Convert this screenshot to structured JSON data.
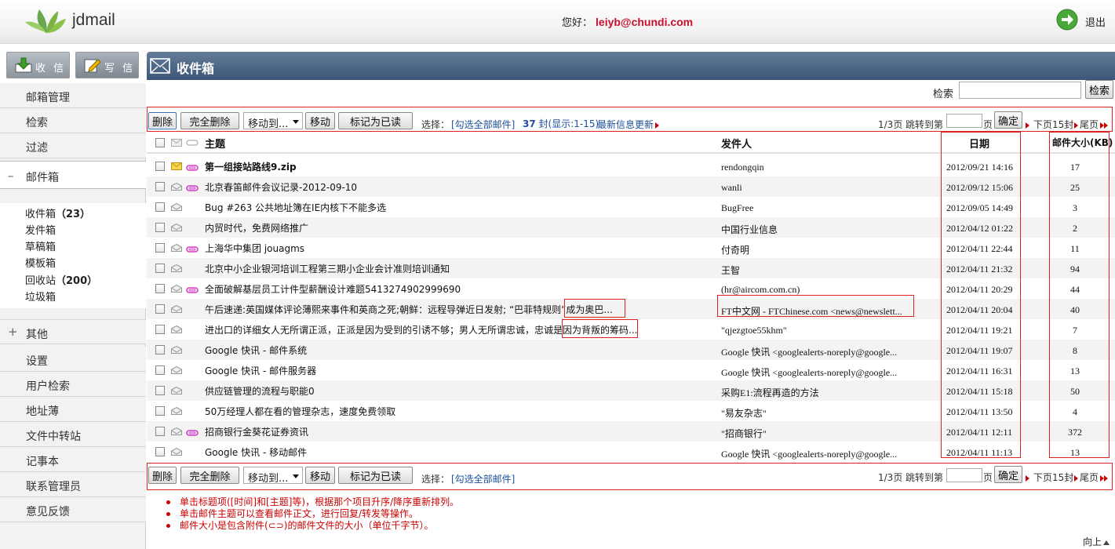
{
  "app": {
    "name": "jdmail",
    "greeting": "您好：",
    "user": "leiyb@chundi.com",
    "logout": "退出"
  },
  "actions": {
    "receive": "收 信",
    "write": "写 信"
  },
  "sidebar": {
    "items": [
      {
        "label": "邮箱管理"
      },
      {
        "label": "检索"
      },
      {
        "label": "过滤"
      },
      {
        "label": "邮件箱",
        "sign": "–"
      }
    ],
    "folders": [
      {
        "label": "收件箱",
        "count": "（23）"
      },
      {
        "label": "发件箱"
      },
      {
        "label": "草稿箱"
      },
      {
        "label": "模板箱"
      },
      {
        "label": "回收站",
        "count": "（200）"
      },
      {
        "label": "垃圾箱"
      }
    ],
    "items2": [
      {
        "label": "其他",
        "sign": "+"
      },
      {
        "label": "设置"
      },
      {
        "label": "用户检索"
      },
      {
        "label": "地址薄"
      },
      {
        "label": "文件中转站"
      },
      {
        "label": "记事本"
      },
      {
        "label": "联系管理员"
      },
      {
        "label": "意见反馈"
      }
    ]
  },
  "page_title": "收件箱",
  "search": {
    "label": "检索",
    "value": "",
    "button": "检索"
  },
  "toolbar": {
    "delete": "删除",
    "perm_delete": "完全删除",
    "move_to": "移动到...",
    "move": "移动",
    "mark_read": "标记为已读",
    "select_label": "选择：",
    "select_all": "[勾选全部邮件]",
    "count_num": "37",
    "count_text": " 封(显示:1-15)",
    "latest": "最新信息更新",
    "page_info": "1/3页",
    "jump_to": "跳转到第",
    "page_unit": "页",
    "confirm": "确定",
    "next": "下页15封",
    "last": "尾页"
  },
  "columns": {
    "subject": "主题",
    "from": "发件人",
    "date": "日期",
    "size": "邮件大小(KB)"
  },
  "emails": [
    {
      "subject": "第一组接站路线9.zip",
      "from": "rendongqin",
      "date": "2012/09/21 14:16",
      "size": "17",
      "unread": true,
      "attach": true
    },
    {
      "subject": "北京春笛邮件会议记录-2012-09-10",
      "from": "wanli",
      "date": "2012/09/12 15:06",
      "size": "25",
      "attach": true
    },
    {
      "subject": "Bug #263 公共地址簿在IE内核下不能多选",
      "from": "BugFree",
      "date": "2012/09/05 14:49",
      "size": "3"
    },
    {
      "subject": "内贸时代，免费网络推广",
      "from": "中国行业信息",
      "date": "2012/04/12 01:22",
      "size": "2"
    },
    {
      "subject": "上海华中集团 jouagms",
      "from": "付奇明",
      "date": "2012/04/11 22:44",
      "size": "11",
      "attach": true
    },
    {
      "subject": "北京中小企业银河培训工程第三期小企业会计准则培训通知",
      "from": "王智",
      "date": "2012/04/11 21:32",
      "size": "94"
    },
    {
      "subject": "全面破解基层员工计件型薪酬设计难题5413274902999690",
      "from": "(hr@aircom.com.cn)",
      "date": "2012/04/11 20:29",
      "size": "44",
      "attach": true
    },
    {
      "subject": "午后速递:英国媒体评论薄熙来事件和英商之死;朝鲜：远程导弹近日发射; “巴菲特规则”成为奥巴...",
      "from": "FT中文网 - FTChinese.com <news@newslett...",
      "date": "2012/04/11 20:04",
      "size": "40"
    },
    {
      "subject": "进出口的详细女人无所谓正派，正派是因为受到的引诱不够；男人无所谓忠诚，忠诚是因为背叛的筹码...",
      "from": "\"qjezgtoe55khm\"",
      "date": "2012/04/11 19:21",
      "size": "7"
    },
    {
      "subject": "Google 快讯 - 邮件系统",
      "from": "Google 快讯 <googlealerts-noreply@google...",
      "date": "2012/04/11 19:07",
      "size": "8"
    },
    {
      "subject": "Google 快讯 - 邮件服务器",
      "from": "Google 快讯 <googlealerts-noreply@google...",
      "date": "2012/04/11 16:31",
      "size": "13"
    },
    {
      "subject": "供应链管理的流程与职能0",
      "from": "采购E1:流程再造的方法",
      "date": "2012/04/11 15:18",
      "size": "50"
    },
    {
      "subject": "50万经理人都在看的管理杂志，速度免费领取",
      "from": "\"易友杂志\"",
      "date": "2012/04/11 13:50",
      "size": "4"
    },
    {
      "subject": "招商银行金葵花证券资讯",
      "from": "\"招商银行\"",
      "date": "2012/04/11 12:11",
      "size": "372",
      "attach": true
    },
    {
      "subject": "Google 快讯 - 移动邮件",
      "from": "Google 快讯 <googlealerts-noreply@google...",
      "date": "2012/04/11 11:13",
      "size": "13"
    }
  ],
  "notes": [
    "单击标题项([时间]和[主题]等)，根据那个项目升序/降序重新排列。",
    "单击邮件主题可以查看邮件正文，进行回复/转发等操作。",
    "邮件大小是包含附件(⊂⊃)的邮件文件的大小（单位千字节）。"
  ],
  "back_to_top": "向上",
  "colors": {
    "accent": "#3b5678",
    "highlight": "#dd2222",
    "link": "#1b4f9b"
  }
}
